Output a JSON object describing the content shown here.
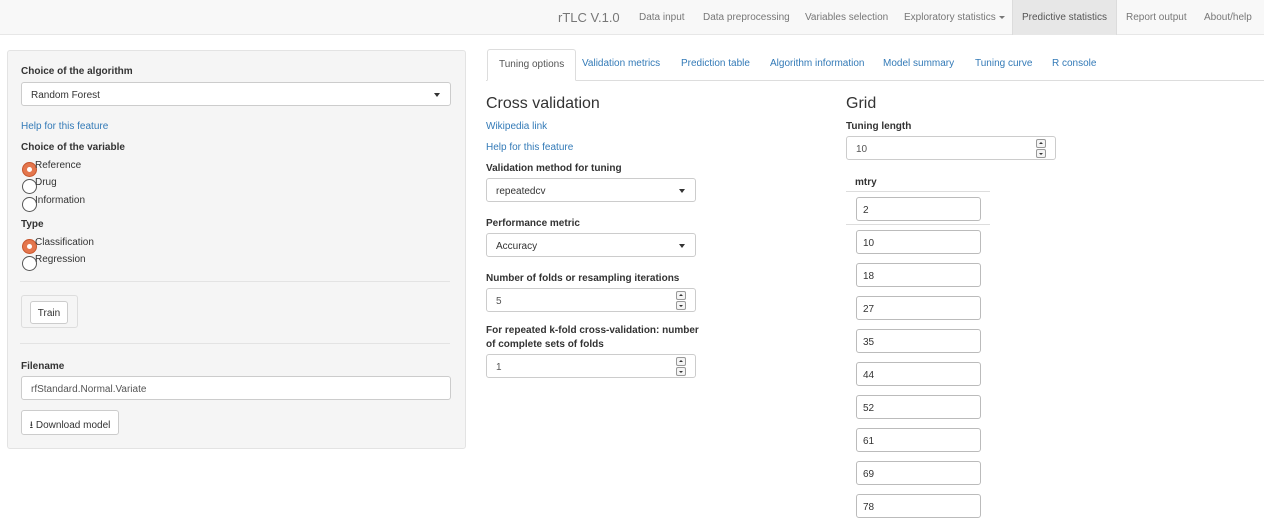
{
  "navbar": {
    "brand": "rTLC V.1.0",
    "items": [
      {
        "label": "Data input"
      },
      {
        "label": "Data preprocessing"
      },
      {
        "label": "Variables selection"
      },
      {
        "label": "Exploratory statistics"
      },
      {
        "label": "Predictive statistics",
        "active": true
      },
      {
        "label": "Report output"
      },
      {
        "label": "About/help"
      }
    ]
  },
  "sidebar": {
    "algorithm_label": "Choice of the algorithm",
    "algorithm_value": "Random Forest",
    "help_link": "Help for this feature",
    "variable_label": "Choice of the variable",
    "variable_options": [
      {
        "label": "Reference",
        "checked": true
      },
      {
        "label": "Drug",
        "checked": false
      },
      {
        "label": "Information",
        "checked": false
      }
    ],
    "type_label": "Type",
    "type_options": [
      {
        "label": "Classification",
        "checked": true
      },
      {
        "label": "Regression",
        "checked": false
      }
    ],
    "train_button": "Train",
    "filename_label": "Filename",
    "filename_value": "rfStandard.Normal.Variate",
    "download_button": "Download model",
    "download_icon": "download-icon"
  },
  "tabs": [
    {
      "label": "Tuning options",
      "active": true
    },
    {
      "label": "Validation metrics"
    },
    {
      "label": "Prediction table"
    },
    {
      "label": "Algorithm information"
    },
    {
      "label": "Model summary"
    },
    {
      "label": "Tuning curve"
    },
    {
      "label": "R console"
    }
  ],
  "cross_validation": {
    "title": "Cross validation",
    "wikipedia_link": "Wikipedia link",
    "help_link": "Help for this feature",
    "method_label": "Validation method for tuning",
    "method_value": "repeatedcv",
    "metric_label": "Performance metric",
    "metric_value": "Accuracy",
    "folds_label": "Number of folds or resampling iterations",
    "folds_value": "5",
    "repeats_label_line1": "For repeated k-fold cross-validation: number",
    "repeats_label_line2": "of complete sets of folds",
    "repeats_value": "1"
  },
  "grid": {
    "title": "Grid",
    "tuning_length_label": "Tuning length",
    "tuning_length_value": "10",
    "column_header": "mtry",
    "mtry_values": [
      "2",
      "10",
      "18",
      "27",
      "35",
      "44",
      "52",
      "61",
      "69",
      "78"
    ]
  }
}
